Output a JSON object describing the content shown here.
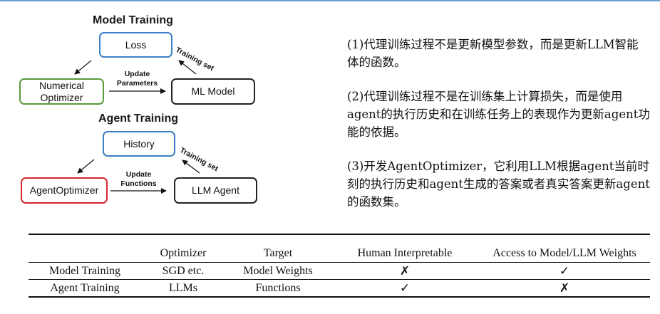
{
  "diagram": {
    "model_training": {
      "title": "Model Training",
      "loss": "Loss",
      "optimizer_line1": "Numerical",
      "optimizer_line2": "Optimizer",
      "model": "ML Model",
      "update_line1": "Update",
      "update_line2": "Parameters",
      "training_set": "Training set"
    },
    "agent_training": {
      "title": "Agent Training",
      "history": "History",
      "optimizer": "AgentOptimizer",
      "agent": "LLM Agent",
      "update_line1": "Update",
      "update_line2": "Functions",
      "training_set": "Training set"
    },
    "colors": {
      "blue": "#3b7fc4",
      "green": "#5a9a3a",
      "red": "#d8262c"
    }
  },
  "notes": [
    "(1)代理训练过程不是更新模型参数，而是更新LLM智能体的函数。",
    "(2)代理训练过程不是在训练集上计算损失，而是使用agent的执行历史和在训练任务上的表现作为更新agent功能的依据。",
    "(3)开发AgentOptimizer，它利用LLM根据agent当前时刻的执行历史和agent生成的答案或者真实答案更新agent的函数集。"
  ],
  "table": {
    "headers": [
      "",
      "Optimizer",
      "Target",
      "Human Interpretable",
      "Access to Model/LLM Weights"
    ],
    "rows": [
      [
        "Model Training",
        "SGD etc.",
        "Model Weights",
        "✗",
        "✓"
      ],
      [
        "Agent Training",
        "LLMs",
        "Functions",
        "✓",
        "✗"
      ]
    ]
  }
}
